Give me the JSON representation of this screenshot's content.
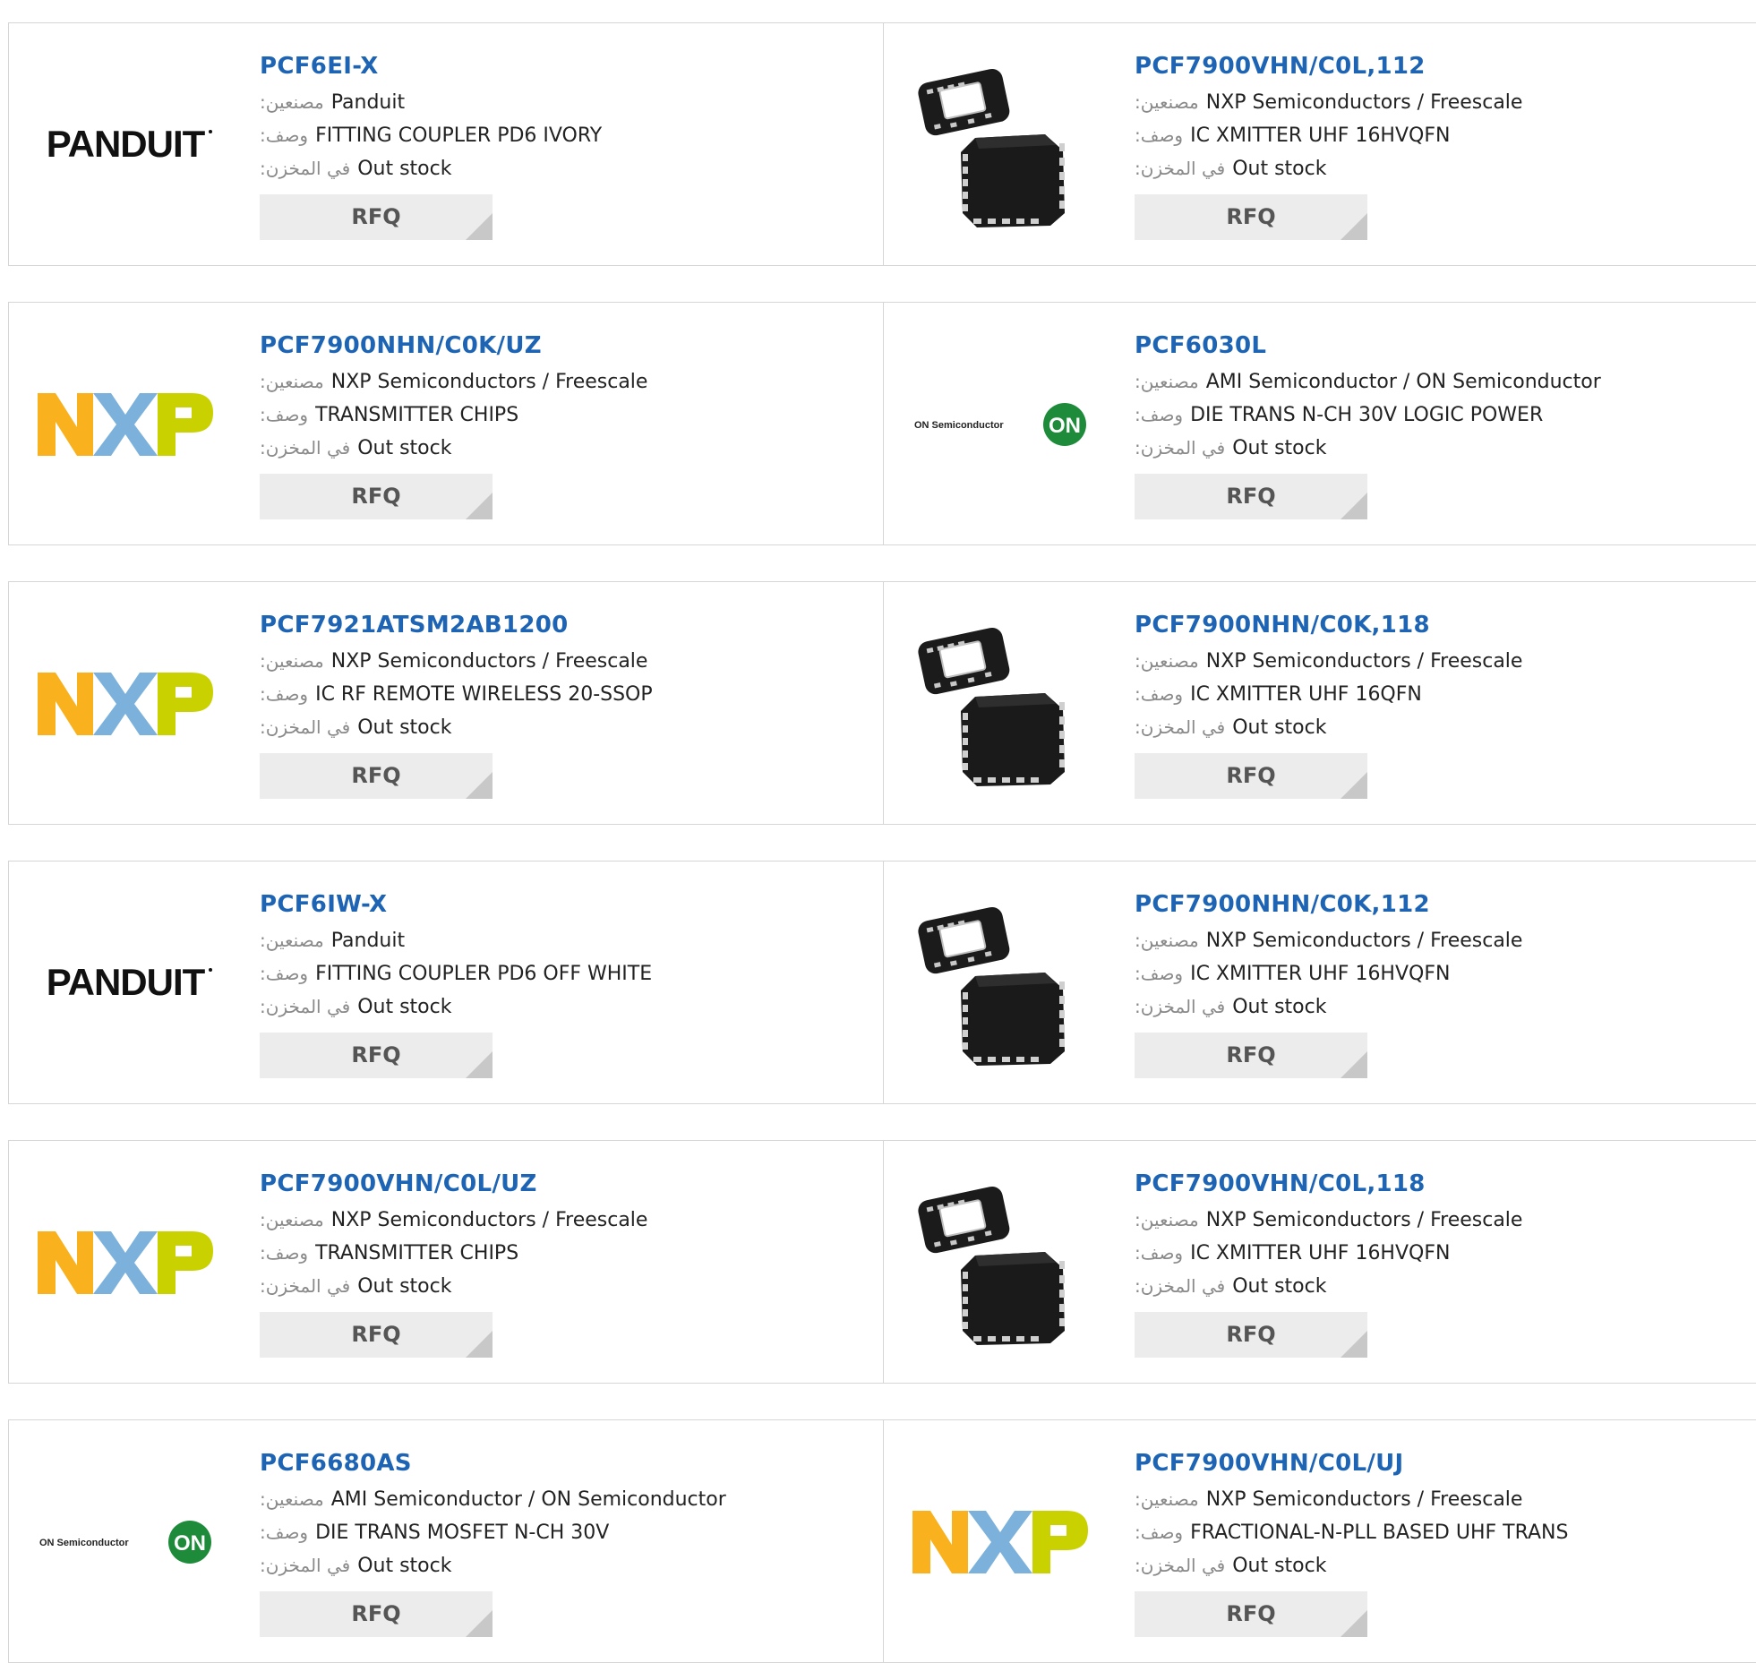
{
  "labels": {
    "manufacturer": ":مصنعين",
    "description": ":وصف",
    "stock": ":في المخزن",
    "rfq": "RFQ"
  },
  "products": [
    {
      "part": "PCF6EI-X",
      "manufacturer": "Panduit",
      "description": "FITTING COUPLER PD6 IVORY",
      "stock": "Out stock",
      "logo": "panduit-logo"
    },
    {
      "part": "PCF7900VHN/C0L,112",
      "manufacturer": "NXP Semiconductors / Freescale",
      "description": "IC XMITTER UHF 16HVQFN",
      "stock": "Out stock",
      "logo": "qfn-chip-photo"
    },
    {
      "part": "PCF7900NHN/C0K/UZ",
      "manufacturer": "NXP Semiconductors / Freescale",
      "description": "TRANSMITTER CHIPS",
      "stock": "Out stock",
      "logo": "nxp-logo"
    },
    {
      "part": "PCF6030L",
      "manufacturer": "AMI Semiconductor / ON Semiconductor",
      "description": "DIE TRANS N-CH 30V LOGIC POWER",
      "stock": "Out stock",
      "logo": "on-semiconductor-logo"
    },
    {
      "part": "PCF7921ATSM2AB1200",
      "manufacturer": "NXP Semiconductors / Freescale",
      "description": "IC RF REMOTE WIRELESS 20-SSOP",
      "stock": "Out stock",
      "logo": "nxp-logo"
    },
    {
      "part": "PCF7900NHN/C0K,118",
      "manufacturer": "NXP Semiconductors / Freescale",
      "description": "IC XMITTER UHF 16QFN",
      "stock": "Out stock",
      "logo": "qfn-chip-photo"
    },
    {
      "part": "PCF6IW-X",
      "manufacturer": "Panduit",
      "description": "FITTING COUPLER PD6 OFF WHITE",
      "stock": "Out stock",
      "logo": "panduit-logo"
    },
    {
      "part": "PCF7900NHN/C0K,112",
      "manufacturer": "NXP Semiconductors / Freescale",
      "description": "IC XMITTER UHF 16HVQFN",
      "stock": "Out stock",
      "logo": "qfn-chip-photo"
    },
    {
      "part": "PCF7900VHN/C0L/UZ",
      "manufacturer": "NXP Semiconductors / Freescale",
      "description": "TRANSMITTER CHIPS",
      "stock": "Out stock",
      "logo": "nxp-logo"
    },
    {
      "part": "PCF7900VHN/C0L,118",
      "manufacturer": "NXP Semiconductors / Freescale",
      "description": "IC XMITTER UHF 16HVQFN",
      "stock": "Out stock",
      "logo": "qfn-chip-photo"
    },
    {
      "part": "PCF6680AS",
      "manufacturer": "AMI Semiconductor / ON Semiconductor",
      "description": "DIE TRANS MOSFET N-CH 30V",
      "stock": "Out stock",
      "logo": "on-semiconductor-logo"
    },
    {
      "part": "PCF7900VHN/C0L/UJ",
      "manufacturer": "NXP Semiconductors / Freescale",
      "description": "FRACTIONAL-N-PLL BASED UHF TRANS",
      "stock": "Out stock",
      "logo": "nxp-logo"
    }
  ],
  "brand_text": {
    "panduit": "PANDUIT",
    "on_small": "ON Semiconductor",
    "on_badge": "ON"
  },
  "colors": {
    "link": "#1e64b4",
    "nxp_orange": "#f9b21d",
    "nxp_blue": "#7bb1db",
    "nxp_green": "#c9d200",
    "on_green": "#1e8b3a"
  }
}
